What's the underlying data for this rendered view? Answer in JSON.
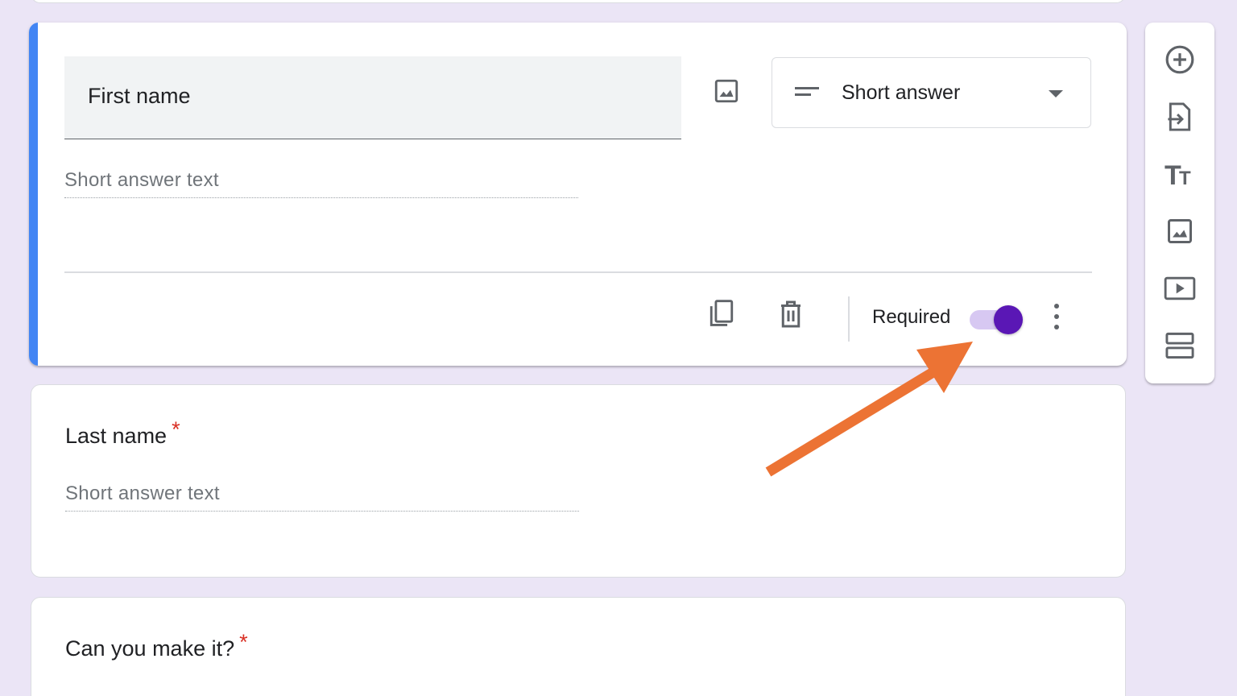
{
  "active_question": {
    "title": "First name",
    "answer_placeholder": "Short answer text",
    "type_selector": {
      "icon": "short-text-icon",
      "label": "Short answer"
    },
    "footer": {
      "duplicate_icon": "copy-icon",
      "delete_icon": "trash-icon",
      "required_label": "Required",
      "required_on": true,
      "more_icon": "more-vert-icon"
    }
  },
  "questions": [
    {
      "title": "Last name",
      "required_mark": "*",
      "answer_placeholder": "Short answer text"
    },
    {
      "title": "Can you make it?",
      "required_mark": "*"
    }
  ],
  "toolbar": {
    "items": [
      {
        "icon": "add-circle-icon",
        "name": "add-question"
      },
      {
        "icon": "import-icon",
        "name": "import-questions"
      },
      {
        "icon": "title-icon",
        "name": "add-title",
        "glyph": "TT"
      },
      {
        "icon": "image-icon",
        "name": "add-image"
      },
      {
        "icon": "video-icon",
        "name": "add-video"
      },
      {
        "icon": "section-icon",
        "name": "add-section"
      }
    ]
  },
  "colors": {
    "background": "#ebe5f6",
    "accent_bar": "#4285f4",
    "toggle_thumb": "#5a17b5",
    "toggle_track": "#d7c8f2",
    "required_star": "#d93025",
    "annotation_arrow": "#ec7334"
  }
}
